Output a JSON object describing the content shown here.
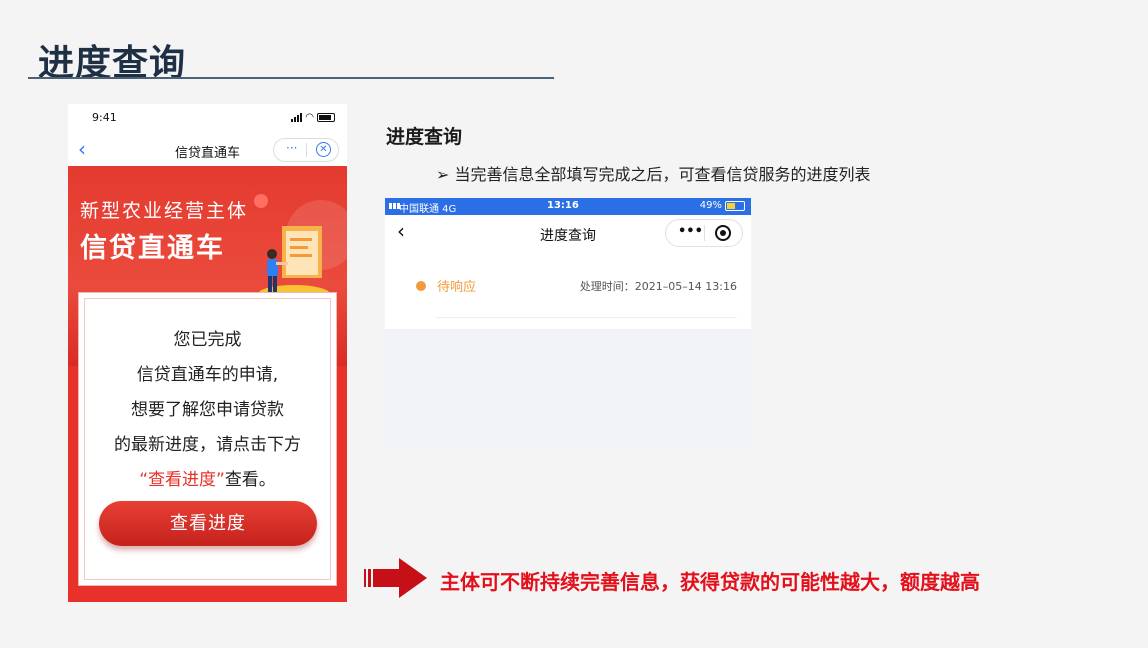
{
  "slide": {
    "title": "进度查询"
  },
  "phone_left": {
    "status_time": "9:41",
    "nav_title": "信贷直通车",
    "back_icon": "chevron-left-icon",
    "more_label": "···",
    "close_icon": "close-circle-icon",
    "banner_line1": "新型农业经营主体",
    "banner_line2": "信贷直通车",
    "card": {
      "line1": "您已完成",
      "line2": "信贷直通车的申请,",
      "line3": "想要了解您申请贷款",
      "line4": "的最新进度，请点击下方",
      "line5_quote": "“查看进度”",
      "line5_rest": "查看。"
    },
    "cta_label": "查看进度",
    "accent_color": "#e7312a"
  },
  "section": {
    "title": "进度查询",
    "bullet": "➢ 当完善信息全部填写完成之后，可查看信贷服务的进度列表"
  },
  "phone_right": {
    "carrier": "中国联通  4G",
    "time": "13:16",
    "battery": "49%",
    "nav_title": "进度查询",
    "more_label": "•••",
    "item": {
      "status": "待响应",
      "time_label": "处理时间：2021–05–14 13:16"
    },
    "status_bar_color": "#2b6fe6",
    "pending_color": "#f39a3c"
  },
  "note": {
    "arrow_icon": "right-arrow-icon",
    "text": "主体可不断持续完善信息，获得贷款的可能性越大，额度越高"
  }
}
